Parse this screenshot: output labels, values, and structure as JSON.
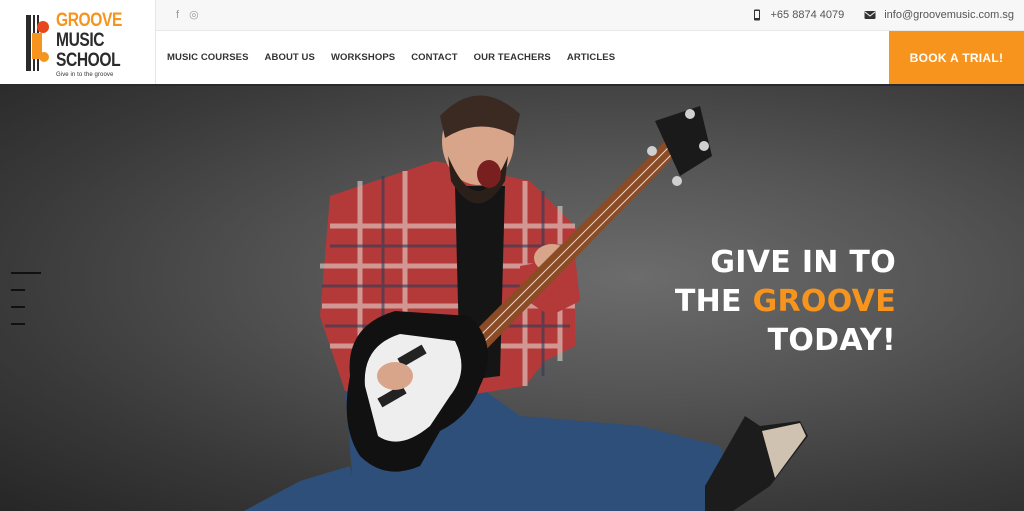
{
  "brand": {
    "name_line1": "GROOVE",
    "name_line2": "MUSIC",
    "name_line3": "SCHOOL",
    "tagline": "Give in to the groove",
    "accent_color": "#f7941d"
  },
  "topbar": {
    "social": [
      {
        "icon": "facebook-icon",
        "glyph": "f"
      },
      {
        "icon": "instagram-icon",
        "glyph": "◎"
      }
    ],
    "phone": {
      "icon": "phone-icon",
      "text": "+65 8874 4079"
    },
    "email": {
      "icon": "mail-icon",
      "text": "info@groovemusic.com.sg"
    }
  },
  "nav": {
    "items": [
      {
        "label": "MUSIC COURSES"
      },
      {
        "label": "ABOUT US"
      },
      {
        "label": "WORKSHOPS"
      },
      {
        "label": "CONTACT"
      },
      {
        "label": "OUR TEACHERS"
      },
      {
        "label": "ARTICLES"
      }
    ],
    "cta_label": "BOOK A TRIAL!"
  },
  "hero": {
    "line1": "GIVE IN TO",
    "line2_prefix": "THE ",
    "line2_accent": "GROOVE",
    "line3": "TODAY!",
    "menu_icon": "hamburger-menu-icon"
  }
}
